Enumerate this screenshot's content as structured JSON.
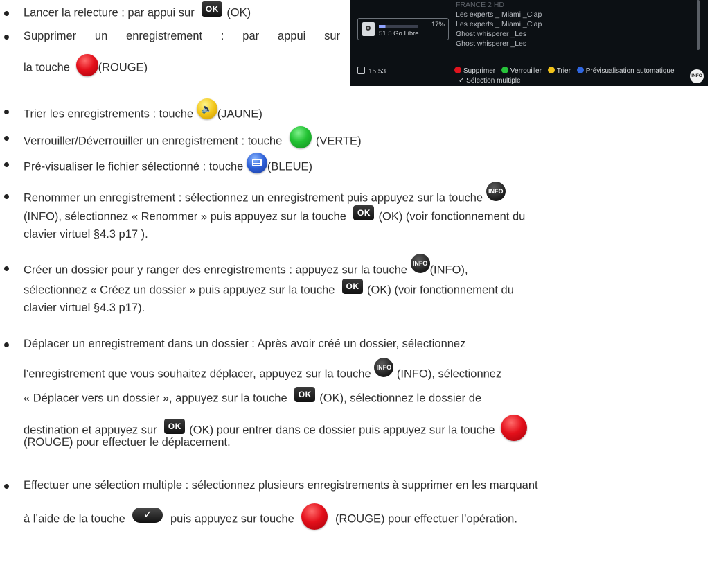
{
  "tv": {
    "rows": [
      "FRANCE 2 HD",
      "Les experts _ Miami _Clap",
      "Les experts _ Miami _Clap",
      "Ghost whisperer _Les",
      "Ghost whisperer _Les"
    ],
    "storage_pct": "17%",
    "storage_used_fraction": 0.17,
    "storage_free": "51.5 Go Libre",
    "time": "15:53",
    "legend_delete": "Supprimer",
    "legend_lock": "Verrouiller",
    "legend_sort": "Trier",
    "legend_preview": "Prévisualisation automatique",
    "legend_multi": "Sélection multiple",
    "info_key": "INFO"
  },
  "keys": {
    "ok": "OK",
    "info": "INFO",
    "check": "✓",
    "yellow_symbol": "🔈"
  },
  "items": {
    "relecture": {
      "text": "Lancer la relecture : par appui sur",
      "suffix": "(OK)"
    },
    "supprimer": {
      "line1": "Supprimer un enregistrement : par appui sur",
      "line2_pre": "la touche",
      "line2_suffix": "(ROUGE)"
    },
    "trier": {
      "text": "Trier les enregistrements : touche",
      "suffix": "(JAUNE)"
    },
    "verrouiller": {
      "text": "Verrouiller/Déverrouiller un enregistrement : touche",
      "suffix": "(VERTE)"
    },
    "previsualiser": {
      "text": "Pré-visualiser le fichier sélectionné : touche",
      "suffix": "(BLEUE)"
    },
    "renommer": {
      "line1": "Renommer un enregistrement : sélectionnez un enregistrement puis appuyez sur la touche",
      "line2_pre": "(INFO), sélectionnez « Renommer » puis appuyez sur la touche",
      "line2_post": "(OK) (voir fonctionnement du",
      "line3": "clavier virtuel §4.3 p17 )."
    },
    "dossier": {
      "line1": "Créer un dossier pour y ranger des enregistrements : appuyez sur la touche",
      "line1_suffix": "(INFO),",
      "line2_pre": "sélectionnez « Créez un dossier » puis appuyez sur la touche",
      "line2_post": "(OK) (voir fonctionnement du",
      "line3": "clavier virtuel §4.3 p17)."
    },
    "deplacer": {
      "line1": "Déplacer un enregistrement dans un dossier : Après avoir créé un dossier, sélectionnez",
      "line2_pre": "l’enregistrement que vous souhaitez déplacer, appuyez sur la touche",
      "line2_post": "(INFO), sélectionnez",
      "line3_pre": "« Déplacer vers un dossier », appuyez sur la touche",
      "line3_post": "(OK), sélectionnez le dossier de",
      "line4_pre": "destination et appuyez sur",
      "line4_post": "(OK) pour entrer dans ce dossier puis appuyez sur la touche",
      "line5": "(ROUGE) pour effectuer le déplacement."
    },
    "selection": {
      "line1": "Effectuer une sélection multiple : sélectionnez plusieurs enregistrements à supprimer en les marquant",
      "line2_pre": "à l’aide de la touche",
      "line2_mid": "puis appuyez sur touche",
      "line2_post": "(ROUGE) pour effectuer l’opération."
    }
  }
}
